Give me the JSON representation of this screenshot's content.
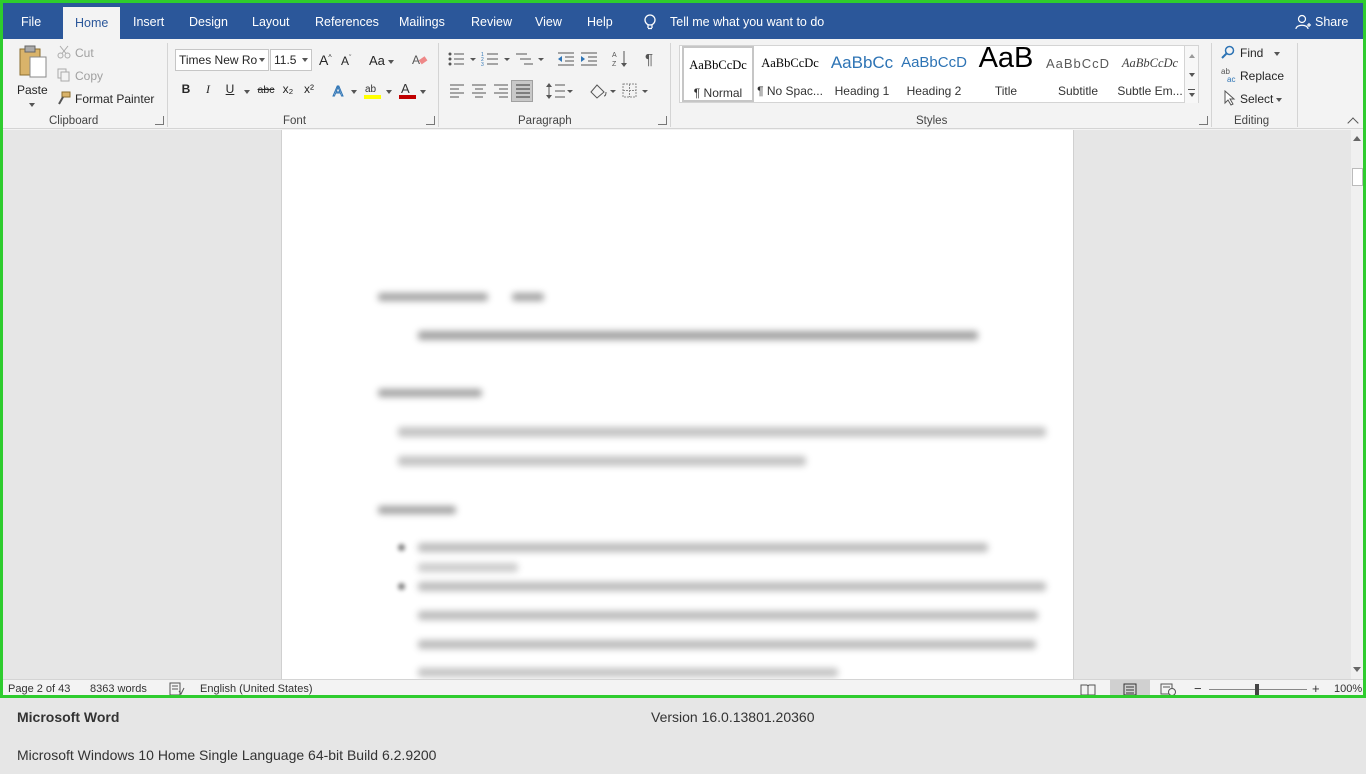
{
  "tabs": [
    "File",
    "Home",
    "Insert",
    "Design",
    "Layout",
    "References",
    "Mailings",
    "Review",
    "View",
    "Help"
  ],
  "active_tab": "Home",
  "tell_me": "Tell me what you want to do",
  "share": "Share",
  "clipboard": {
    "paste": "Paste",
    "cut": "Cut",
    "copy": "Copy",
    "format_painter": "Format Painter",
    "label": "Clipboard"
  },
  "font": {
    "name": "Times New Ro",
    "size": "11.5",
    "change_case": "Aa",
    "bold": "B",
    "italic": "I",
    "underline": "U",
    "strike": "abc",
    "subscript": "x₂",
    "superscript": "x²",
    "label": "Font"
  },
  "paragraph": {
    "label": "Paragraph"
  },
  "styles": {
    "items": [
      {
        "preview": "AaBbCcDc",
        "name": "¶ Normal"
      },
      {
        "preview": "AaBbCcDc",
        "name": "¶ No Spac..."
      },
      {
        "preview": "AaBbCc",
        "name": "Heading 1"
      },
      {
        "preview": "AaBbCcD",
        "name": "Heading 2"
      },
      {
        "preview": "AaB",
        "name": "Title"
      },
      {
        "preview": "AaBbCcD",
        "name": "Subtitle"
      },
      {
        "preview": "AaBbCcDc",
        "name": "Subtle Em..."
      }
    ],
    "label": "Styles"
  },
  "editing": {
    "find": "Find",
    "replace": "Replace",
    "select": "Select",
    "label": "Editing"
  },
  "status": {
    "page": "Page 2 of 43",
    "words": "8363 words",
    "language": "English (United States)",
    "zoom": "100%"
  },
  "about": {
    "product": "Microsoft Word",
    "version": "Version 16.0.13801.20360",
    "os": "Microsoft Windows 10 Home Single Language 64-bit Build 6.2.9200"
  },
  "colors": {
    "ribbon_blue": "#2b579a",
    "frame_green": "#2ecc2e",
    "font_color": "#c00000",
    "highlight": "#ffff00",
    "heading_blue": "#2e74b5"
  }
}
